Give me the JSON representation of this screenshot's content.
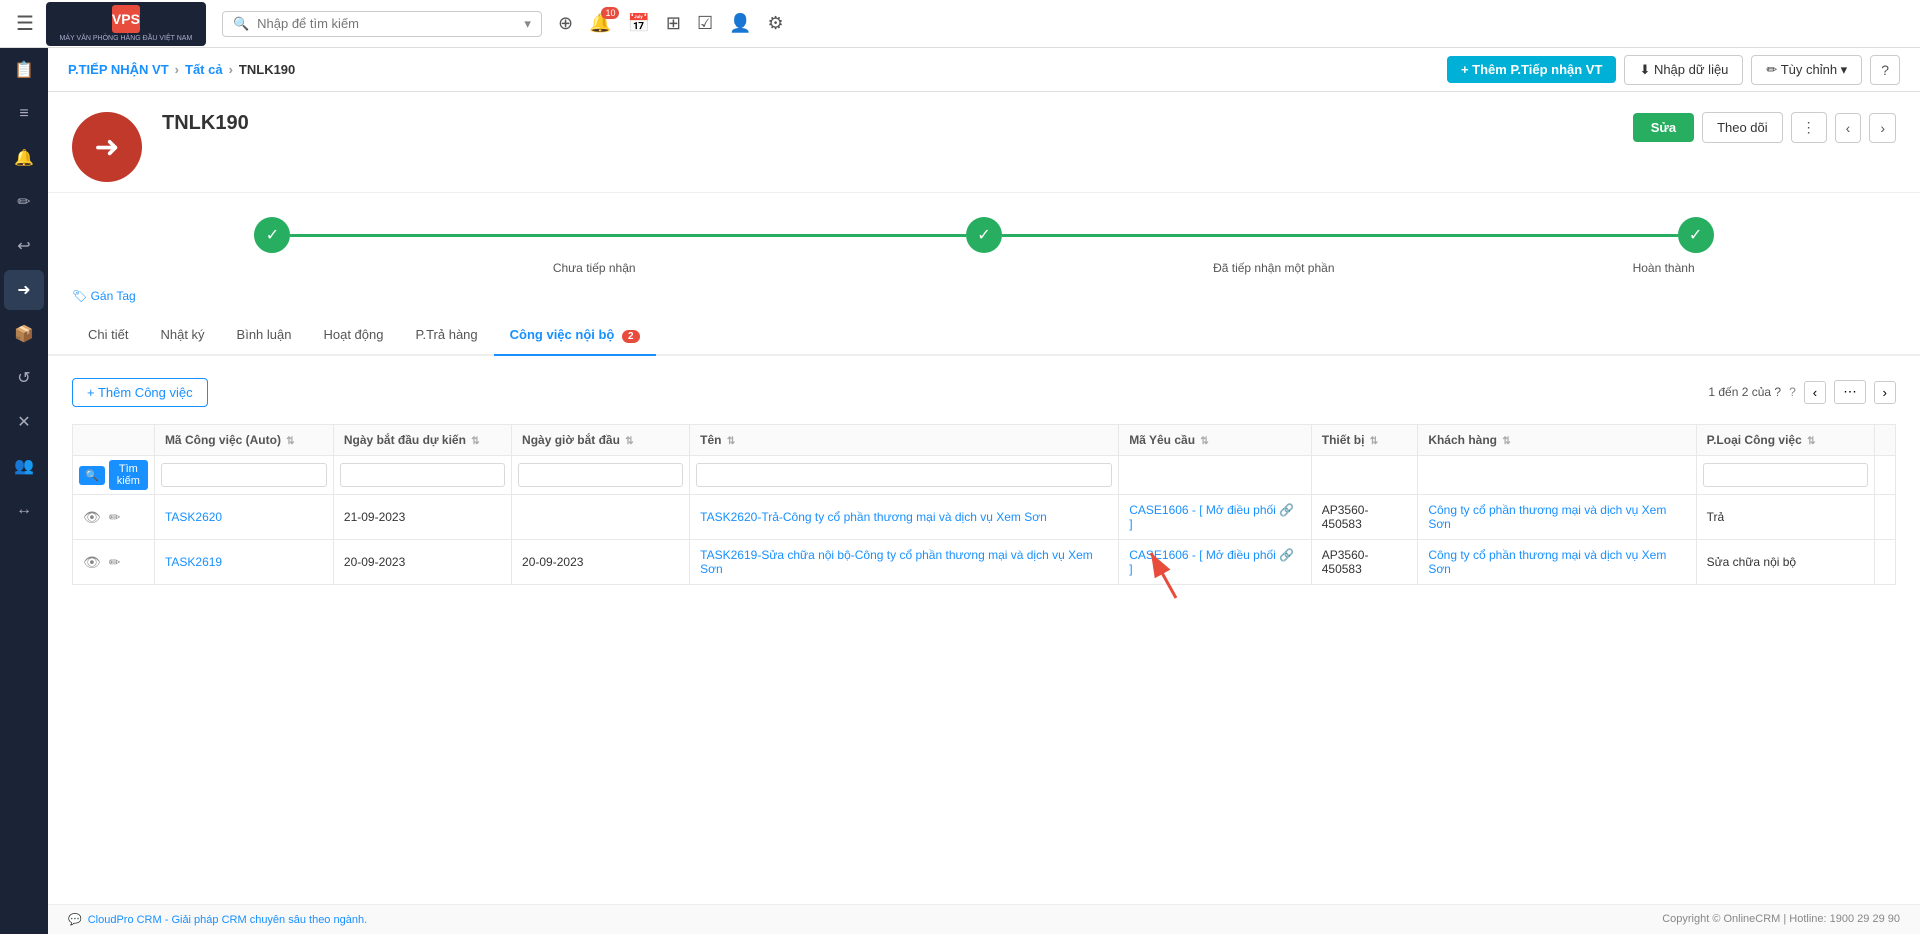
{
  "topbar": {
    "menu_icon": "☰",
    "logo_line1": "MÁY VĂN PHÒNG HÀNG ĐẦU VIỆT NAM",
    "search_placeholder": "Nhập để tìm kiếm",
    "notification_count": "10"
  },
  "breadcrumb": {
    "module": "P.TIẾP NHẬN VT",
    "parent": "Tất cả",
    "current": "TNLK190",
    "btn_add": "+ Thêm P.Tiếp nhận VT",
    "btn_import": "⬇ Nhập dữ liệu",
    "btn_customize": "✏ Tùy chỉnh",
    "help_icon": "?"
  },
  "record": {
    "code": "TNLK190",
    "avatar_icon": "→",
    "btn_edit": "Sửa",
    "btn_follow": "Theo dõi",
    "btn_more": "⋮",
    "btn_prev": "‹",
    "btn_next": "›"
  },
  "progress": {
    "steps": [
      {
        "label": "Chưa tiếp nhận",
        "done": true
      },
      {
        "label": "Đã tiếp nhận một phần",
        "done": true
      },
      {
        "label": "Hoàn thành",
        "done": true,
        "active": true
      }
    ]
  },
  "tag_section": {
    "label": "🏷 Gán Tag"
  },
  "tabs": {
    "items": [
      {
        "label": "Chi tiết",
        "active": false,
        "badge": null
      },
      {
        "label": "Nhật ký",
        "active": false,
        "badge": null
      },
      {
        "label": "Bình luận",
        "active": false,
        "badge": null
      },
      {
        "label": "Hoạt động",
        "active": false,
        "badge": null
      },
      {
        "label": "P.Trả hàng",
        "active": false,
        "badge": null
      },
      {
        "label": "Công việc nội bộ",
        "active": true,
        "badge": "2"
      }
    ]
  },
  "task_section": {
    "btn_add": "+ Thêm Công việc",
    "pagination": "1 đến 2 của ?",
    "table": {
      "columns": [
        {
          "label": "",
          "sortable": false
        },
        {
          "label": "Mã Công việc (Auto)",
          "sortable": true
        },
        {
          "label": "Ngày bắt đầu dự kiến",
          "sortable": true
        },
        {
          "label": "Ngày giờ bắt đầu",
          "sortable": true
        },
        {
          "label": "Tên",
          "sortable": true
        },
        {
          "label": "Mã Yêu cầu",
          "sortable": true
        },
        {
          "label": "Thiết bị",
          "sortable": true
        },
        {
          "label": "Khách hàng",
          "sortable": true
        },
        {
          "label": "P.Loại Công việc",
          "sortable": true
        },
        {
          "label": "",
          "sortable": false
        }
      ],
      "search_row": {
        "show_icon": "🔍",
        "btn_search": "Tìm kiếm"
      },
      "rows": [
        {
          "id": "TASK2620",
          "start_expected": "21-09-2023",
          "start_datetime": "",
          "name": "TASK2620-Trả-Công ty cổ phần thương mại và dịch vụ Xem Sơn",
          "case": "CASE1606 - [ Mở điều phối 🔗 ]",
          "device": "AP3560-450583",
          "customer": "Công ty cổ phần thương mại và dịch vụ Xem Sơn",
          "type": "Trả"
        },
        {
          "id": "TASK2619",
          "start_expected": "20-09-2023",
          "start_datetime": "20-09-2023",
          "name": "TASK2619-Sửa chữa nội bộ-Công ty cổ phần thương mại và dịch vụ Xem Sơn",
          "case": "CASE1606 - [ Mở điều phối 🔗 ]",
          "device": "AP3560-450583",
          "customer": "Công ty cổ phần thương mại và dịch vụ Xem Sơn",
          "type": "Sửa chữa nội bộ"
        }
      ]
    }
  },
  "sidebar": {
    "items": [
      {
        "icon": "⊞",
        "name": "home"
      },
      {
        "icon": "📋",
        "name": "tasks"
      },
      {
        "icon": "≡",
        "name": "list"
      },
      {
        "icon": "🔔",
        "name": "notifications"
      },
      {
        "icon": "✏",
        "name": "edit"
      },
      {
        "icon": "↩",
        "name": "return"
      },
      {
        "icon": "➜",
        "name": "receive",
        "active": true
      },
      {
        "icon": "📦",
        "name": "packages"
      },
      {
        "icon": "↺",
        "name": "refresh"
      },
      {
        "icon": "✕",
        "name": "cancel"
      },
      {
        "icon": "👥",
        "name": "users"
      },
      {
        "icon": "↔",
        "name": "transfer"
      }
    ]
  },
  "footer": {
    "chat_icon": "💬",
    "chat_text": "CloudPro CRM - Giải pháp CRM chuyên sâu theo ngành.",
    "copyright": "Copyright © OnlineCRM | Hotline: 1900 29 29 90"
  }
}
